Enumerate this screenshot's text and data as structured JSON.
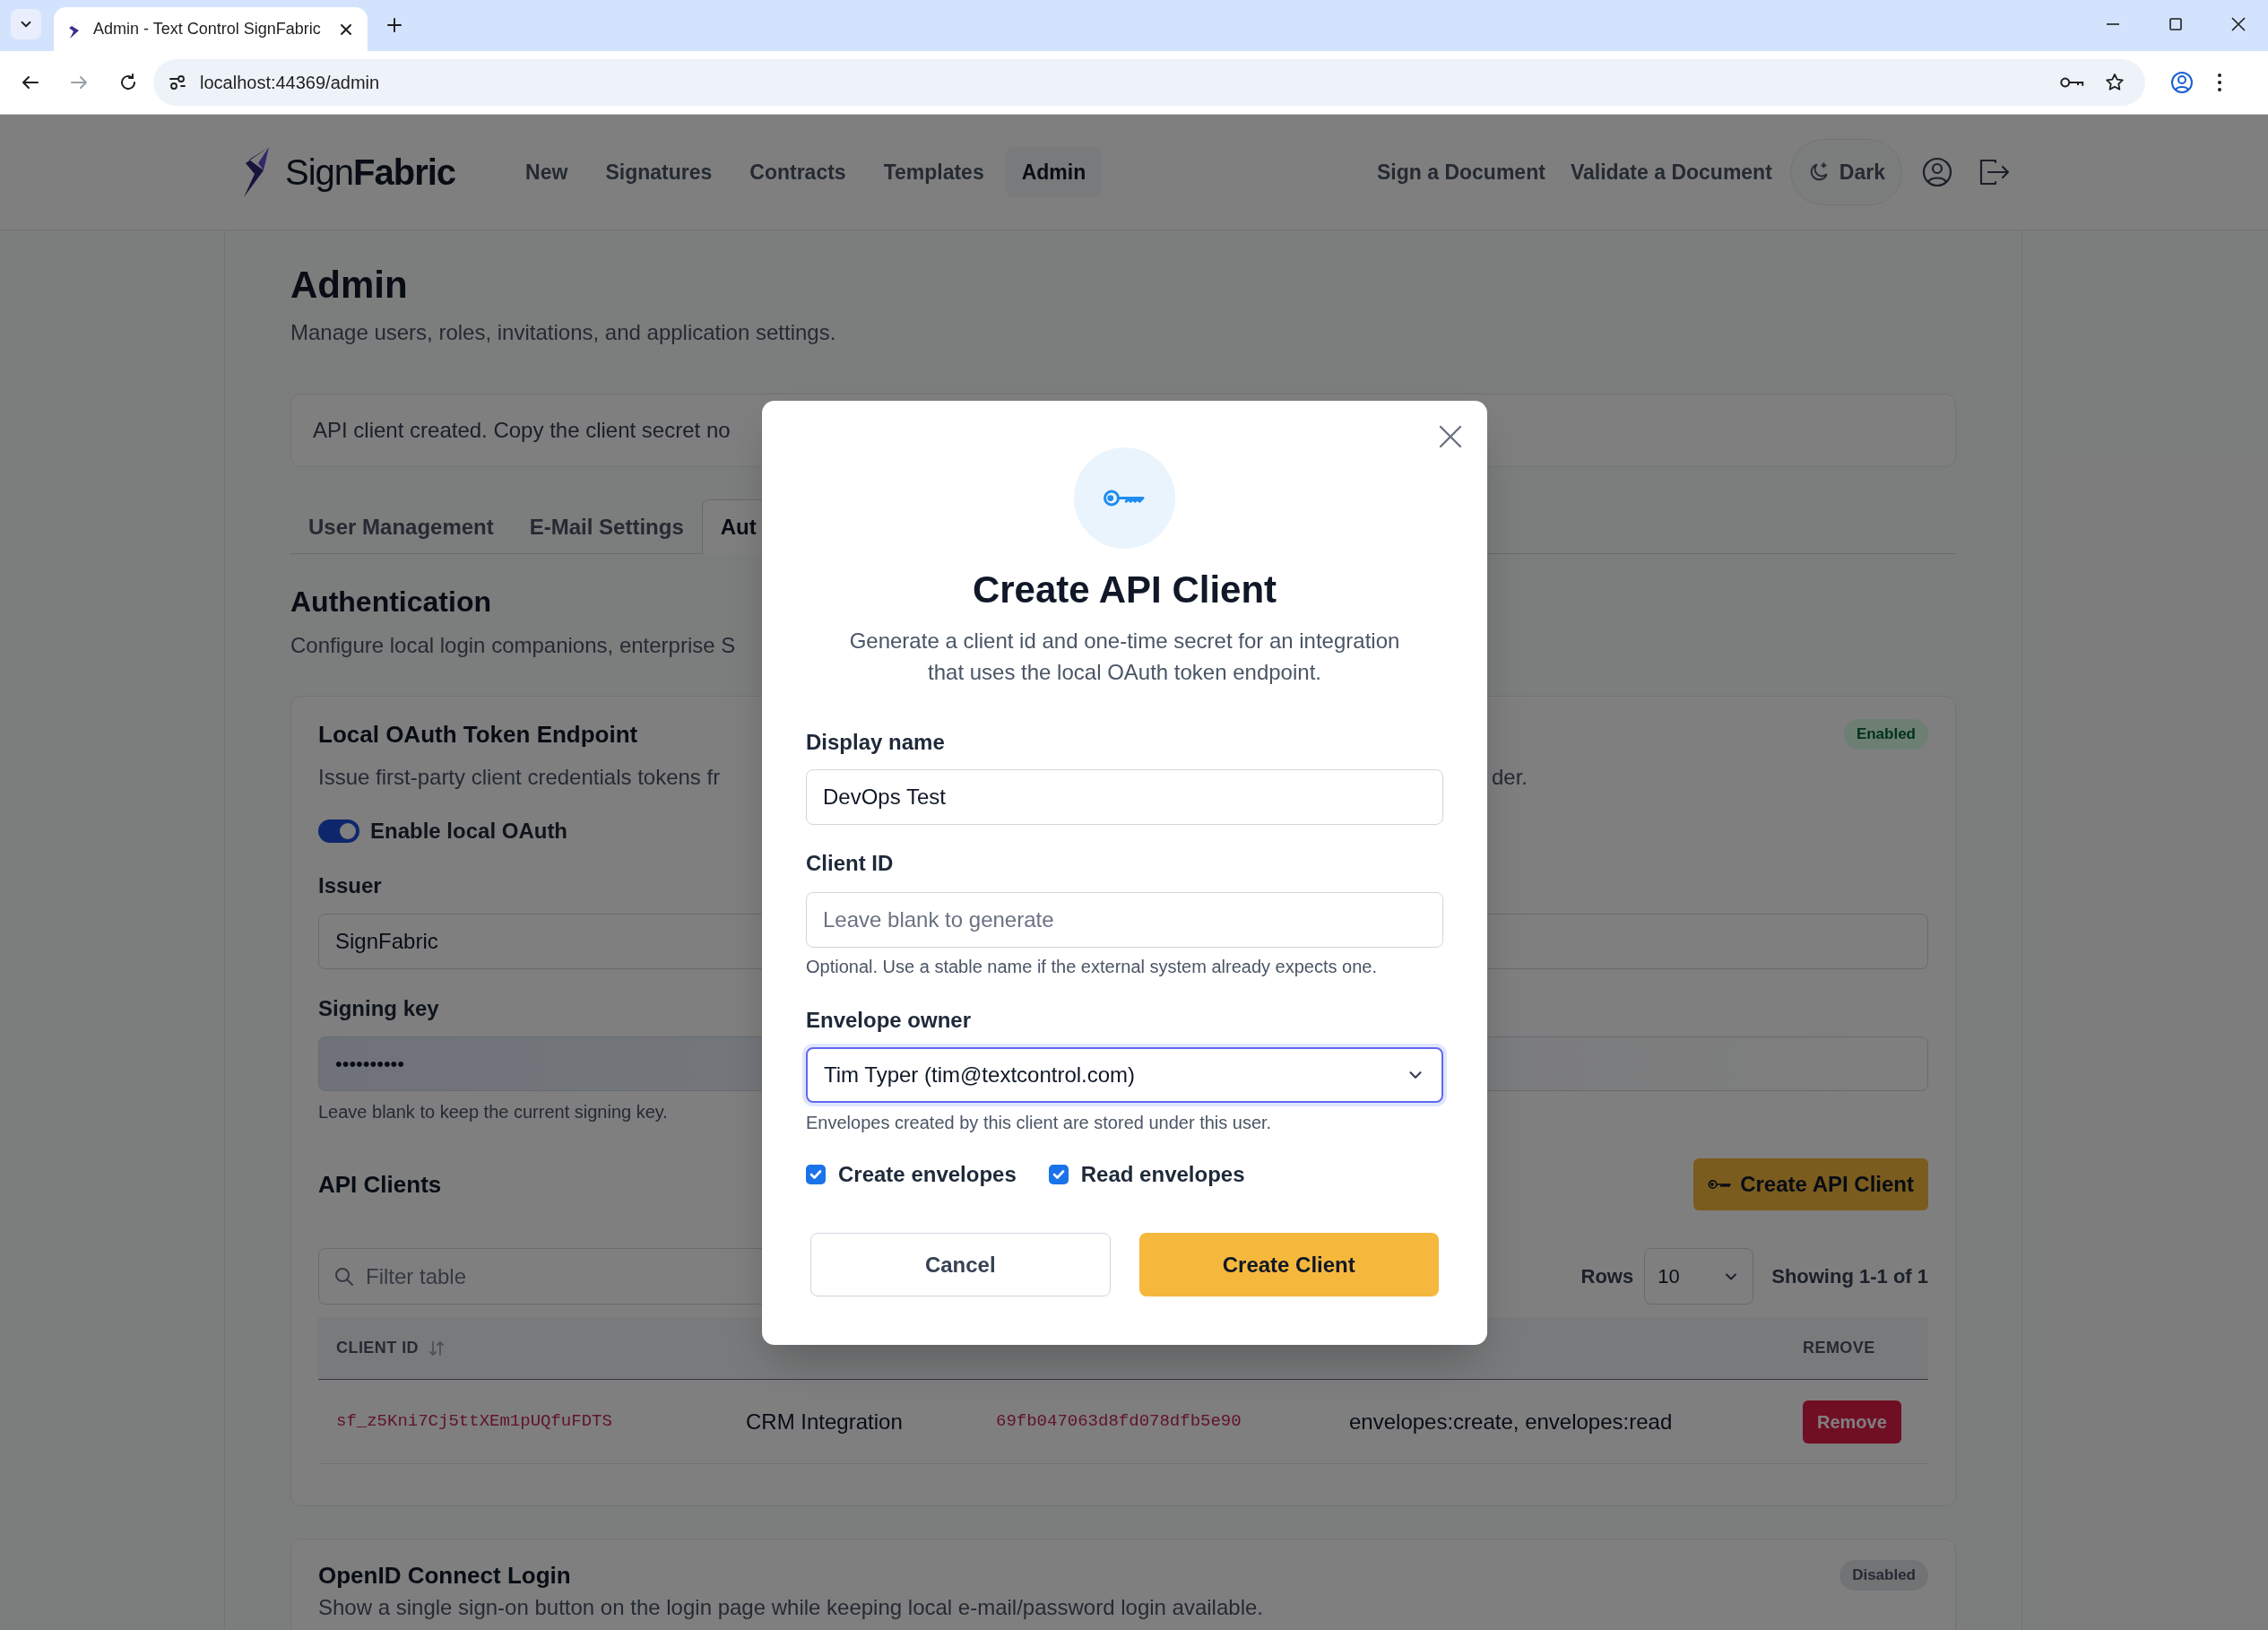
{
  "browser": {
    "tab_title": "Admin - Text Control SignFabric",
    "url": "localhost:44369/admin"
  },
  "nav": {
    "logo": {
      "light": "Sign",
      "bold": "Fabric"
    },
    "items": [
      {
        "label": "New",
        "selected": false
      },
      {
        "label": "Signatures",
        "selected": false
      },
      {
        "label": "Contracts",
        "selected": false
      },
      {
        "label": "Templates",
        "selected": false
      },
      {
        "label": "Admin",
        "selected": true
      }
    ],
    "right_links": [
      "Sign a Document",
      "Validate a Document"
    ],
    "theme_button": "Dark"
  },
  "page": {
    "title": "Admin",
    "subtitle": "Manage users, roles, invitations, and application settings."
  },
  "alert": "API client created. Copy the client secret no",
  "tabs": [
    {
      "label": "User Management",
      "selected": false
    },
    {
      "label": "E-Mail Settings",
      "selected": false
    },
    {
      "label": "Aut",
      "selected": true
    }
  ],
  "section": {
    "title": "Authentication",
    "description": "Configure local login companions, enterprise S"
  },
  "oauth_card": {
    "title": "Local OAuth Token Endpoint",
    "status": {
      "label": "Enabled",
      "kind": "enabled"
    },
    "description": "Issue first-party client credentials tokens fr",
    "description_tail": "der.",
    "toggle": {
      "label": "Enable local OAuth",
      "on": true
    },
    "issuer": {
      "label": "Issuer",
      "value": "SignFabric"
    },
    "signing_key": {
      "label": "Signing key",
      "value": "••••••••••",
      "help": "Leave blank to keep the current signing key."
    }
  },
  "api_clients": {
    "title": "API Clients",
    "create_button": "Create API Client",
    "filter_placeholder": "Filter table",
    "rows_label": "Rows",
    "rows_value": "10",
    "showing": "Showing 1-1 of 1",
    "columns": [
      {
        "label": "CLIENT ID",
        "sortable": true,
        "kind": "code"
      },
      {
        "kind": "text"
      },
      {
        "kind": "code"
      },
      {
        "kind": "text"
      },
      {
        "label": "REMOVE",
        "sortable": false,
        "kind": "action"
      }
    ],
    "rows": [
      {
        "cells": [
          "sf_z5Kni7Cj5ttXEm1pUQfuFDTS",
          "CRM Integration",
          "69fb047063d8fd078dfb5e90",
          "envelopes:create, envelopes:read",
          "Remove"
        ]
      }
    ]
  },
  "openid_card": {
    "title": "OpenID Connect Login",
    "status": {
      "label": "Disabled",
      "kind": "disabled"
    },
    "description": "Show a single sign-on button on the login page while keeping local e-mail/password login available."
  },
  "modal": {
    "title": "Create API Client",
    "description": "Generate a client id and one-time secret for an integration that uses the local OAuth token endpoint.",
    "fields": [
      {
        "kind": "text",
        "label": "Display name",
        "value": "DevOps Test"
      },
      {
        "kind": "text",
        "label": "Client ID",
        "placeholder": "Leave blank to generate",
        "help": "Optional. Use a stable name if the external system already expects one."
      },
      {
        "kind": "select",
        "label": "Envelope owner",
        "value": "Tim Typer (tim@textcontrol.com)",
        "help": "Envelopes created by this client are stored under this user.",
        "focused": true
      }
    ],
    "scopes": [
      {
        "label": "Create envelopes",
        "checked": true
      },
      {
        "label": "Read envelopes",
        "checked": true
      }
    ],
    "buttons": [
      {
        "label": "Cancel",
        "kind": "secondary"
      },
      {
        "label": "Create Client",
        "kind": "primary"
      }
    ]
  }
}
